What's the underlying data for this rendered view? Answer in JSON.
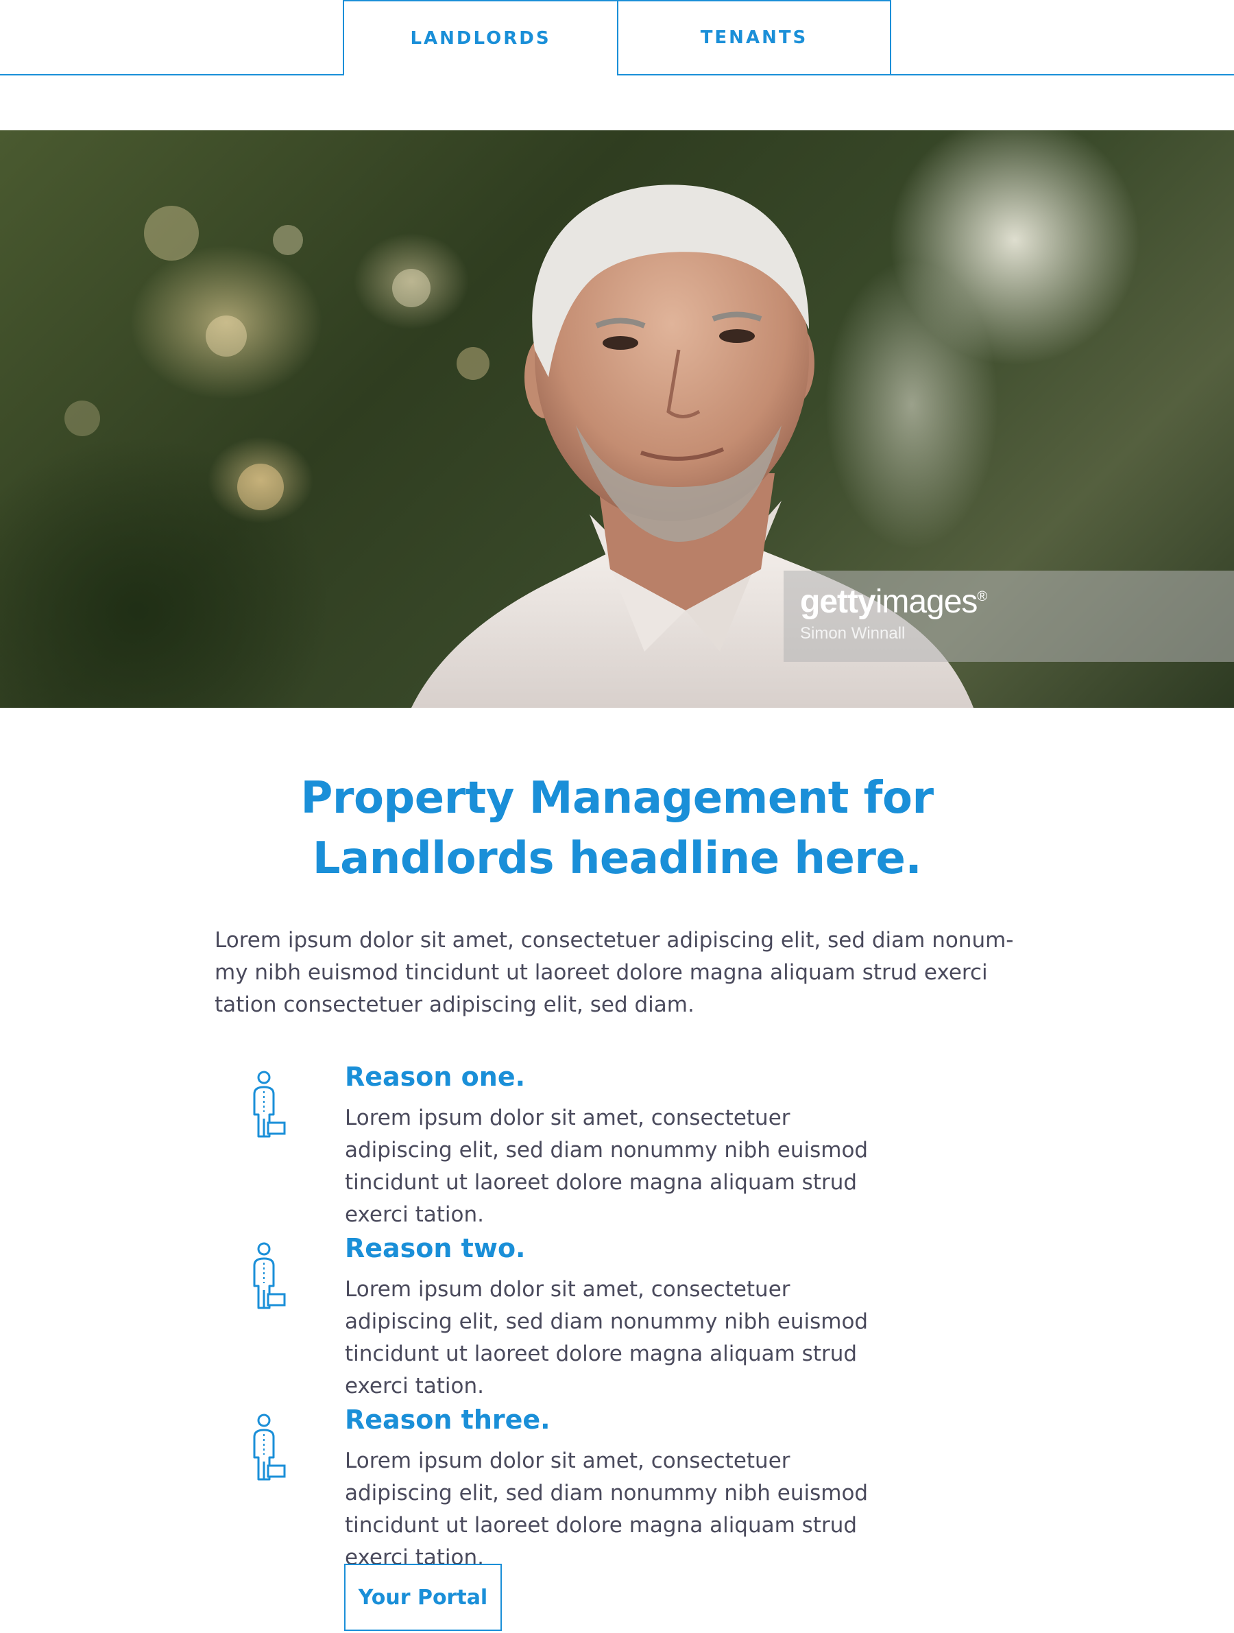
{
  "tabs": [
    {
      "label": "LANDLORDS",
      "active": true
    },
    {
      "label": "TENANTS",
      "active": false
    }
  ],
  "hero": {
    "watermark_logo_bold": "getty",
    "watermark_logo_light": "images",
    "watermark_mark": "®",
    "watermark_credit": "Simon Winnall"
  },
  "content": {
    "headline_line1": "Property Management for",
    "headline_line2": "Landlords headline here.",
    "intro": "Lorem ipsum dolor sit amet, consectetuer adipiscing elit, sed diam nonum-my nibh euismod tincidunt ut laoreet dolore magna aliquam strud exerci tation consectetuer adipiscing elit, sed diam.",
    "reasons": [
      {
        "title": "Reason one.",
        "body": "Lorem ipsum dolor sit amet, consectetuer adipiscing elit, sed diam nonummy nibh euismod tincidunt ut laoreet dolore magna aliquam strud exerci tation.",
        "icon": "businessman-icon"
      },
      {
        "title": "Reason two.",
        "body": "Lorem ipsum dolor sit amet, consectetuer adipiscing elit, sed diam nonummy nibh euismod tincidunt ut laoreet dolore magna aliquam strud exerci tation.",
        "icon": "businessman-icon"
      },
      {
        "title": "Reason three.",
        "body": "Lorem ipsum dolor sit amet, consectetuer adipiscing elit, sed diam nonummy nibh euismod tincidunt ut laoreet dolore magna aliquam strud exerci tation.",
        "icon": "businessman-icon"
      }
    ],
    "cta_label": "Your Portal"
  },
  "colors": {
    "accent": "#1a8fd8",
    "body_text": "#4a4a5c",
    "background": "#ffffff"
  }
}
